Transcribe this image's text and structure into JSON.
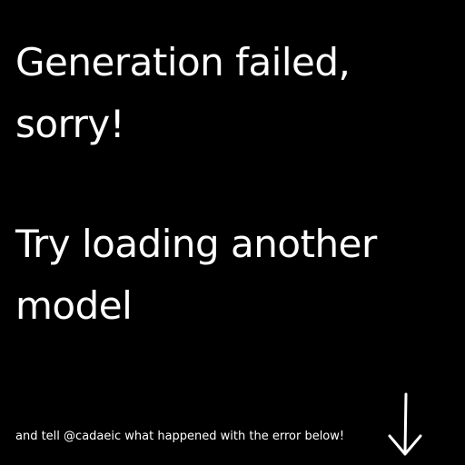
{
  "message": {
    "line1": "Generation failed,",
    "line2": "sorry!",
    "line3": "Try loading another",
    "line4": "model"
  },
  "footer": {
    "text": "and tell @cadaeic what happened with the error below!",
    "arrow_icon": "down-arrow-icon"
  },
  "colors": {
    "background": "#000000",
    "text": "#ffffff"
  }
}
